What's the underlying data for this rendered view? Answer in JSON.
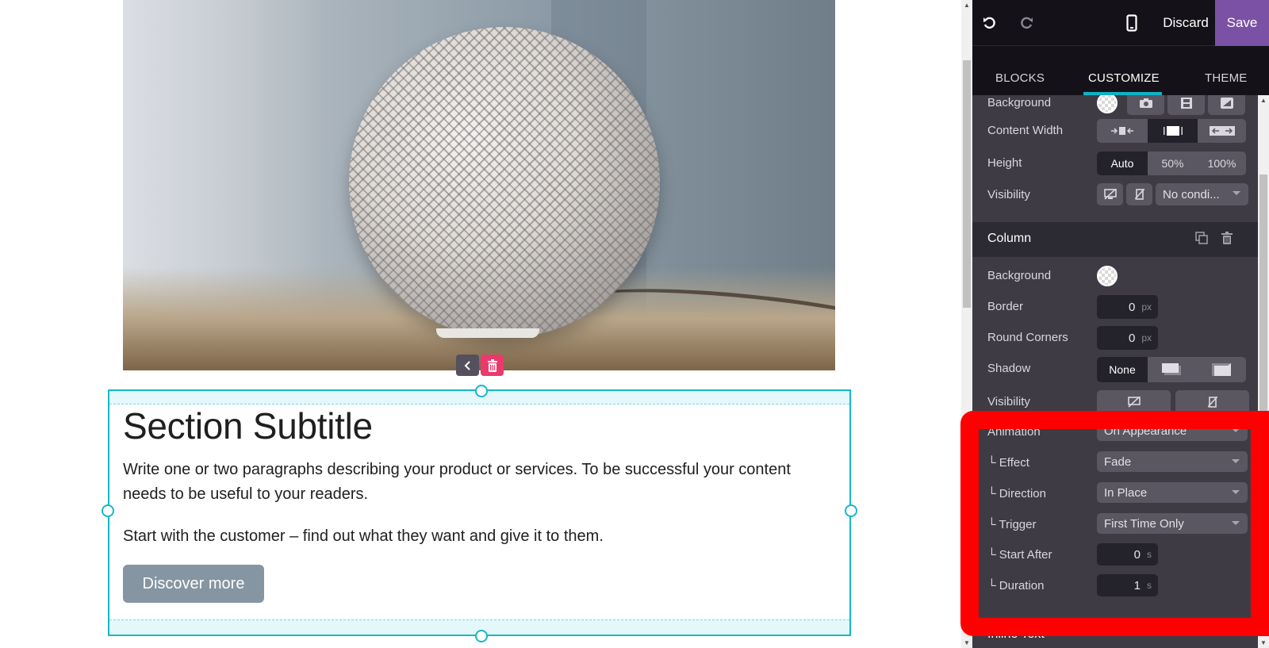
{
  "canvas": {
    "image_alt": "Smart speaker on wooden shelf",
    "image_tools": {
      "back_icon": "chevron-left",
      "delete_icon": "trash"
    },
    "section": {
      "title": "Section Subtitle",
      "paragraph1": "Write one or two paragraphs describing your product or services. To be successful your content needs to be useful to your readers.",
      "paragraph2": "Start with the customer – find out what they want and give it to them.",
      "button_label": "Discover more"
    }
  },
  "toolbar": {
    "undo_icon": "↶",
    "redo_icon": "↷",
    "mobile_icon": "▯",
    "discard_label": "Discard",
    "save_label": "Save"
  },
  "tabs": [
    {
      "label": "BLOCKS"
    },
    {
      "label": "CUSTOMIZE",
      "active": true
    },
    {
      "label": "THEME"
    }
  ],
  "section_options": {
    "background": {
      "label": "Background"
    },
    "content_width": {
      "label": "Content Width",
      "selected": "default"
    },
    "height": {
      "label": "Height",
      "options": [
        "Auto",
        "50%",
        "100%"
      ],
      "selected": "Auto"
    },
    "visibility": {
      "label": "Visibility",
      "condition": "No condi..."
    }
  },
  "column": {
    "title": "Column",
    "background": {
      "label": "Background"
    },
    "border": {
      "label": "Border",
      "value": "0",
      "unit": "px"
    },
    "round_corners": {
      "label": "Round Corners",
      "value": "0",
      "unit": "px"
    },
    "shadow": {
      "label": "Shadow",
      "options": [
        "None"
      ],
      "selected": "None"
    },
    "visibility": {
      "label": "Visibility"
    },
    "animation": {
      "label": "Animation",
      "value": "On Appearance"
    },
    "effect": {
      "label": "└ Effect",
      "value": "Fade"
    },
    "direction": {
      "label": "└ Direction",
      "value": "In Place"
    },
    "trigger": {
      "label": "└ Trigger",
      "value": "First Time Only"
    },
    "start_after": {
      "label": "└ Start After",
      "value": "0",
      "unit": "s"
    },
    "duration": {
      "label": "└ Duration",
      "value": "1",
      "unit": "s"
    }
  },
  "next_section": {
    "title": "Inline Text"
  },
  "colors": {
    "accent": "#0fb1c7",
    "save": "#7b51a5",
    "delete": "#ea3a6b",
    "highlight": "#ff0000"
  }
}
